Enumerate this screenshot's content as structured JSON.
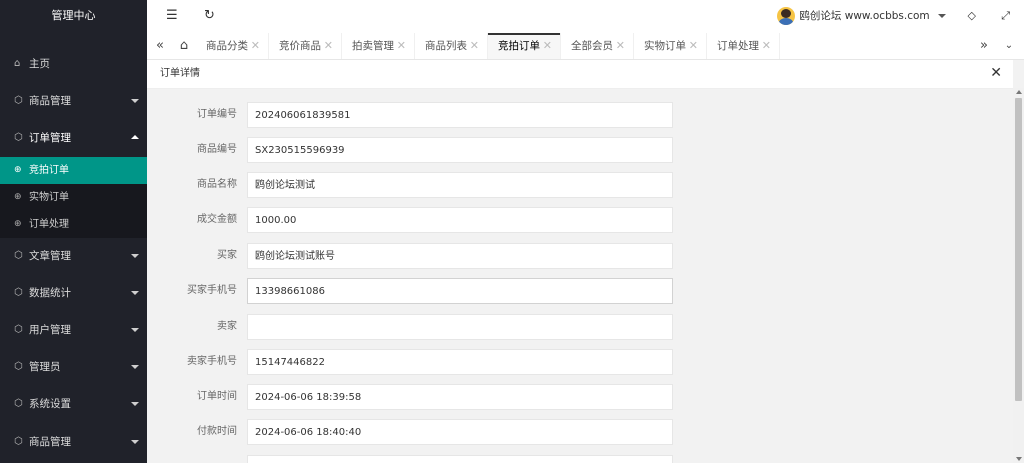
{
  "sidebar": {
    "title": "管理中心",
    "items": [
      {
        "label": "主页",
        "icon": "home-icon"
      },
      {
        "label": "商品管理",
        "icon": "cube-icon"
      },
      {
        "label": "订单管理",
        "icon": "cube-icon"
      },
      {
        "label": "文章管理",
        "icon": "cube-icon"
      },
      {
        "label": "数据统计",
        "icon": "cube-icon"
      },
      {
        "label": "用户管理",
        "icon": "cube-icon"
      },
      {
        "label": "管理员",
        "icon": "cube-icon"
      },
      {
        "label": "系统设置",
        "icon": "cube-icon"
      },
      {
        "label": "商品管理",
        "icon": "cube-icon"
      }
    ],
    "order_sub": [
      {
        "label": "竞拍订单",
        "active": true
      },
      {
        "label": "实物订单",
        "active": false
      },
      {
        "label": "订单处理",
        "active": false
      }
    ]
  },
  "topbar": {
    "user_name": "鸥创论坛 www.ocbbs.com"
  },
  "tabs": [
    {
      "label": "商品分类"
    },
    {
      "label": "竞价商品"
    },
    {
      "label": "拍卖管理"
    },
    {
      "label": "商品列表"
    },
    {
      "label": "竞拍订单",
      "active": true
    },
    {
      "label": "全部会员"
    },
    {
      "label": "实物订单"
    },
    {
      "label": "订单处理"
    }
  ],
  "panel": {
    "title": "订单详情"
  },
  "fields": [
    {
      "label": "订单编号",
      "value": "202406061839581"
    },
    {
      "label": "商品编号",
      "value": "SX230515596939"
    },
    {
      "label": "商品名称",
      "value": "鸥创论坛测试"
    },
    {
      "label": "成交金额",
      "value": "1000.00"
    },
    {
      "label": "买家",
      "value": "鸥创论坛测试账号"
    },
    {
      "label": "买家手机号",
      "value": "13398661086"
    },
    {
      "label": "卖家",
      "value": ""
    },
    {
      "label": "卖家手机号",
      "value": "15147446822"
    },
    {
      "label": "订单时间",
      "value": "2024-06-06 18:39:58"
    },
    {
      "label": "付款时间",
      "value": "2024-06-06 18:40:40"
    }
  ],
  "colors": {
    "sidebar_bg": "#20222a",
    "active_item": "#009688"
  }
}
